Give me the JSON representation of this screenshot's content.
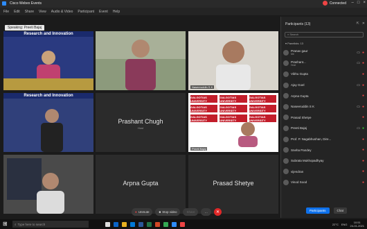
{
  "window": {
    "app_title": "Cisco Webex Events",
    "conn_label": "Connected",
    "win_controls": [
      "–",
      "□",
      "×"
    ]
  },
  "menu": [
    "File",
    "Edit",
    "Share",
    "View",
    "Audio & Video",
    "Participant",
    "Event",
    "Help"
  ],
  "speaking_label": "Speaking: Preeti Bajaj",
  "tiles": [
    {
      "name": "Banner",
      "banner": "Research and Innovation",
      "tag": "",
      "colors": {
        "bg": "#2a3a80"
      }
    },
    {
      "name": "Man with glasses",
      "tag": ""
    },
    {
      "name": "Naseeruddin S K",
      "tag": "Naseeruddin S K"
    },
    {
      "name": "Research and Innovation",
      "banner": "Research and Innovation",
      "tag": ""
    },
    {
      "name": "Prashant Chugh",
      "sub": "Host"
    },
    {
      "name": "Preeti Bajaj",
      "tag": "Preeti Bajaj"
    },
    {
      "name": "Presenter",
      "tag": ""
    },
    {
      "name": "Arpna Gupta"
    },
    {
      "name": "Prasad Shetye"
    }
  ],
  "logo_text": "GALGOTIAS UNIVERSITY",
  "panel": {
    "title": "Participants (13)",
    "search_placeholder": "Search",
    "group_label": "Panelists: 13",
    "participants": [
      {
        "name": "Pranav gaur",
        "role": "Me"
      },
      {
        "name": "Prashant...",
        "role": "Host"
      },
      {
        "name": "Vibhu Gupta",
        "role": ""
      },
      {
        "name": "Ajay Goel",
        "role": ""
      },
      {
        "name": "Arpna Gupta",
        "role": ""
      },
      {
        "name": "Naseeruddin S K",
        "role": ""
      },
      {
        "name": "Prasad Shetye",
        "role": ""
      },
      {
        "name": "Preeti Bajaj",
        "role": ""
      },
      {
        "name": "Prof. P. Nagabhushan, Dire...",
        "role": ""
      },
      {
        "name": "Sneha Pandey",
        "role": ""
      },
      {
        "name": "Subrata Mukhopadhyay",
        "role": ""
      },
      {
        "name": "vijendran",
        "role": ""
      },
      {
        "name": "Vinod Sood",
        "role": ""
      }
    ],
    "btn_participants": "Participants",
    "btn_chat": "Chat"
  },
  "controls": {
    "unmute": "Unmute",
    "stop_video": "Stop video",
    "share": "Share",
    "more": "…"
  },
  "taskbar": {
    "search_placeholder": "Type here to search",
    "temp": "22°C",
    "lang": "ENG",
    "time": "10:51",
    "date": "24-01-2021"
  },
  "colors": {
    "accent": "#0e71eb",
    "end": "#e02828",
    "mute": "#e44"
  }
}
